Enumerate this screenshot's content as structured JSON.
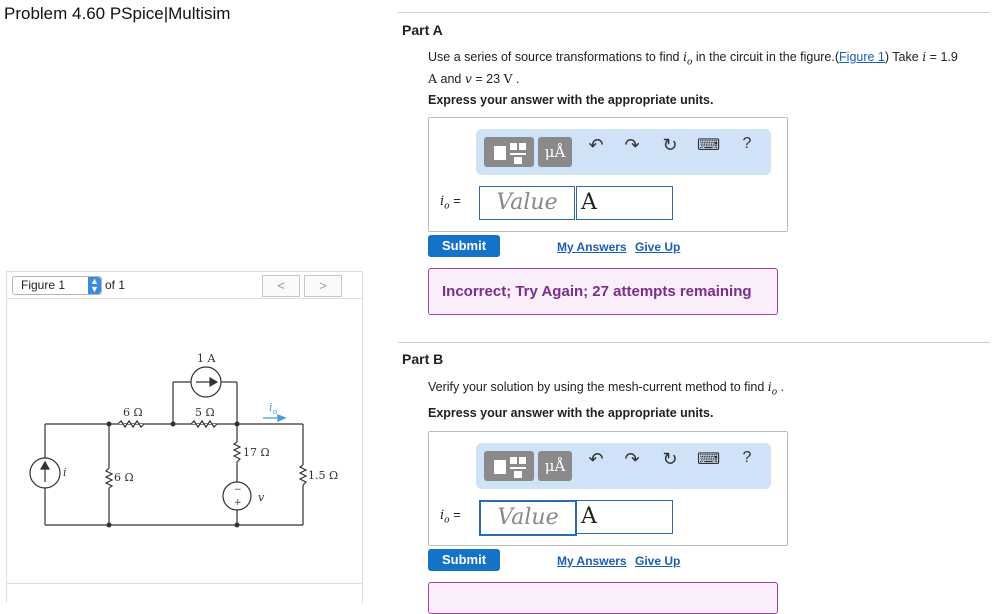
{
  "problem_title": "Problem 4.60 PSpice|Multisim",
  "partA": {
    "heading": "Part A",
    "question_pre": "Use a series of source transformations to find",
    "question_var": "i",
    "question_sub": "o",
    "question_mid": " in the circuit in the figure.(",
    "figure_link": "Figure 1",
    "question_post": ") Take",
    "take_var_i": "i",
    "take_i_val": " = 1.9",
    "line2_unitA": "A",
    "line2_and": " and ",
    "line2_var_v": "v",
    "line2_v_val": " = 23 ",
    "line2_unitV": "V",
    "line2_end": " .",
    "express": "Express your answer with the appropriate units.",
    "answer_label_var": "i",
    "answer_label_sub": "o",
    "answer_label_eq": " =",
    "value_placeholder": "Value",
    "unit_value": "A",
    "submit": "Submit",
    "my_answers": "My Answers",
    "give_up": "Give Up",
    "feedback": "Incorrect; Try Again; 27 attempts remaining"
  },
  "partB": {
    "heading": "Part B",
    "question_pre": "Verify your solution by using the mesh-current method to find",
    "question_var": "i",
    "question_sub": "o",
    "question_end": " .",
    "express": "Express your answer with the appropriate units.",
    "answer_label_var": "i",
    "answer_label_sub": "o",
    "answer_label_eq": " =",
    "value_placeholder": "Value",
    "unit_value": "A",
    "submit": "Submit",
    "my_answers": "My Answers",
    "give_up": "Give Up"
  },
  "toolbar": {
    "units_button": "μÅ",
    "help": "?"
  },
  "figure": {
    "select_label": "Figure 1",
    "of_label": "of 1",
    "prev": "<",
    "next": ">"
  },
  "circuit": {
    "src_1A": "1 A",
    "r_6a": "6 Ω",
    "r_5": "5 Ω",
    "r_17": "17 Ω",
    "r_6b": "6 Ω",
    "r_15": "1.5 Ω",
    "i_label": "i",
    "v_label": "v",
    "io_label": "i",
    "io_sub": "o",
    "plus": "+",
    "minus": "−"
  }
}
